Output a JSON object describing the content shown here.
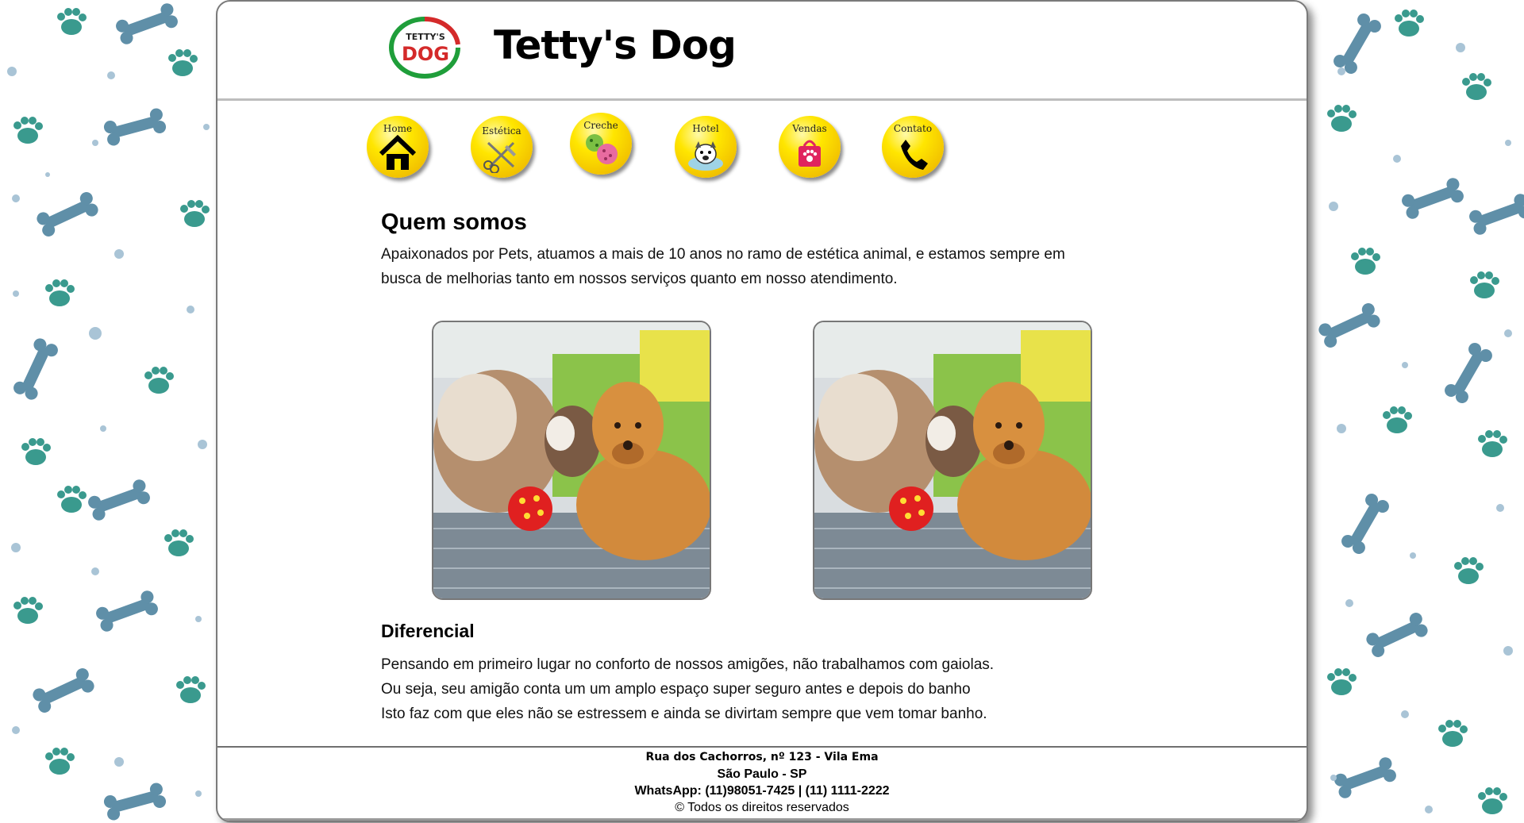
{
  "site": {
    "title": "Tetty's Dog",
    "logo_top": "TETTY'S",
    "logo_main": "DOG"
  },
  "nav": {
    "items": [
      {
        "label": "Home",
        "icon": "house-icon"
      },
      {
        "label": "Estética",
        "icon": "scissors-comb-icon"
      },
      {
        "label": "Creche",
        "icon": "balls-icon"
      },
      {
        "label": "Hotel",
        "icon": "dog-bed-icon"
      },
      {
        "label": "Vendas",
        "icon": "shopping-bag-icon"
      },
      {
        "label": "Contato",
        "icon": "phone-icon"
      }
    ]
  },
  "about": {
    "heading": "Quem somos",
    "text_line1": "Apaixonados por Pets, atuamos a mais de 10 anos no ramo de estética animal, e estamos sempre em",
    "text_line2": "busca de melhorias tanto em nossos serviços quanto em nosso atendimento."
  },
  "differential": {
    "heading": "Diferencial",
    "lines": [
      "Pensando em primeiro lugar no conforto de nossos amigões, não trabalhamos com gaiolas.",
      "Ou seja, seu amigão conta um um amplo espaço super seguro antes e depois do banho",
      "Isto faz com que eles não se estressem e ainda se divirtam sempre que vem tomar banho."
    ]
  },
  "footer": {
    "address": "Rua dos Cachorros, nº 123 - Vila Ema",
    "city": "São Paulo - SP",
    "whatsapp": "WhatsApp: (11)98051-7425 | (11) 1111-2222",
    "rights": "© Todos os direitos reservados"
  },
  "colors": {
    "paw": "#3a9a8e",
    "bone": "#5f8fa8",
    "dot": "#a9c4d6",
    "nav_yellow": "#ffe600",
    "logo_red": "#d42a2a",
    "logo_green": "#1f9e3a"
  }
}
